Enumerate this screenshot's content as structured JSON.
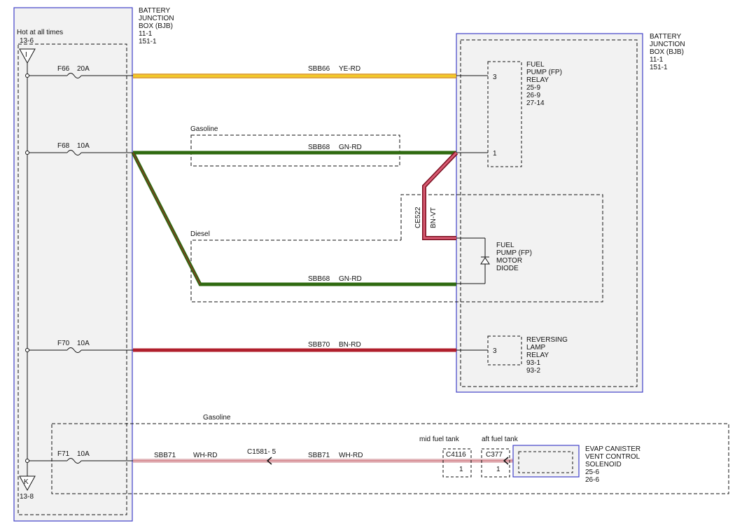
{
  "bjb_left": {
    "title": [
      "BATTERY",
      "JUNCTION",
      "BOX (BJB)",
      "11-1",
      "151-1"
    ],
    "hot_label": "Hot at all times",
    "top_connector": {
      "ref": "13-6",
      "letter": "I"
    },
    "bottom_connector": {
      "ref": "13-8",
      "letter": "K"
    }
  },
  "bjb_right": {
    "title": [
      "BATTERY",
      "JUNCTION",
      "BOX (BJB)",
      "11-1",
      "151-1"
    ]
  },
  "fuses": [
    {
      "id": "F66",
      "rating": "20A"
    },
    {
      "id": "F68",
      "rating": "10A"
    },
    {
      "id": "F70",
      "rating": "10A"
    },
    {
      "id": "F71",
      "rating": "10A"
    }
  ],
  "wires": {
    "sbb66": {
      "circuit": "SBB66",
      "color": "YE-RD"
    },
    "sbb68_gas": {
      "circuit": "SBB68",
      "color": "GN-RD"
    },
    "sbb68_diesel": {
      "circuit": "SBB68",
      "color": "GN-RD"
    },
    "sbb70": {
      "circuit": "SBB70",
      "color": "BN-RD"
    },
    "sbb71_a": {
      "circuit": "SBB71",
      "color": "WH-RD"
    },
    "sbb71_b": {
      "circuit": "SBB71",
      "color": "WH-RD"
    },
    "ce522": {
      "circuit": "CE522",
      "color": "BN-VT"
    }
  },
  "variants": {
    "gasoline_top": "Gasoline",
    "diesel": "Diesel",
    "gasoline_bottom": "Gasoline"
  },
  "components": {
    "fuel_pump_relay": {
      "label": [
        "FUEL",
        "PUMP (FP)",
        "RELAY",
        "25-9",
        "26-9",
        "27-14"
      ],
      "pins": [
        "3",
        "1"
      ]
    },
    "fuel_pump_motor_diode": {
      "label": [
        "FUEL",
        "PUMP (FP)",
        "MOTOR",
        "DIODE"
      ]
    },
    "reversing_lamp_relay": {
      "label": [
        "REVERSING",
        "LAMP",
        "RELAY",
        "93-1",
        "93-2"
      ],
      "pin": "3"
    },
    "evap_solenoid": {
      "label": [
        "EVAP CANISTER",
        "VENT CONTROL",
        "SOLENOID",
        "25-6",
        "26-6"
      ]
    }
  },
  "connectors": {
    "c1581": {
      "name": "C1581- 5"
    },
    "c4116": {
      "name": "C4116",
      "pin": "1",
      "location": "mid fuel tank"
    },
    "c377": {
      "name": "C377",
      "pin": "1",
      "location": "aft fuel tank"
    }
  },
  "colors": {
    "box_border": "#4040c8",
    "box_fill": "#f2f2f2",
    "wire_green": "#2f6a10",
    "wire_red": "#b01f2c",
    "wire_yellow": "#f0c000",
    "wire_orange": "#d88a00",
    "wire_bnvt": "#c8324a"
  }
}
